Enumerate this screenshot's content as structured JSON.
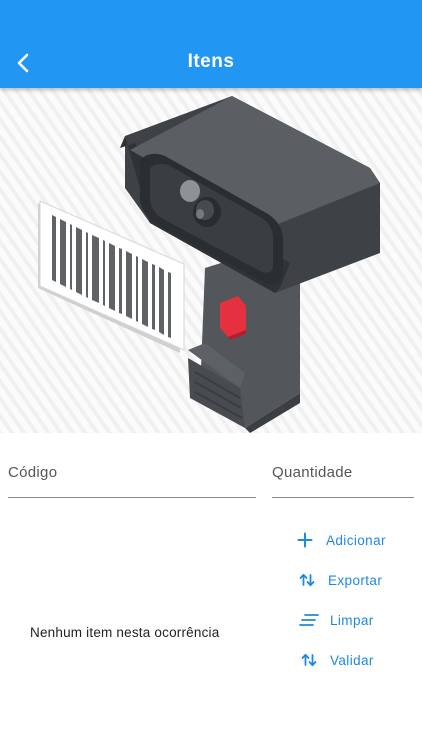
{
  "appbar": {
    "title": "Itens",
    "back_icon": "chevron-left-icon",
    "color": "#2196f3"
  },
  "hero": {
    "image": "barcode-scanner-illustration"
  },
  "form": {
    "code_placeholder": "Código",
    "quantity_placeholder": "Quantidade"
  },
  "empty_message": "Nenhum item nesta ocorrência",
  "actions": [
    {
      "label": "Adicionar",
      "icon": "plus-icon"
    },
    {
      "label": "Exportar",
      "icon": "swap-vertical-icon"
    },
    {
      "label": "Limpar",
      "icon": "clear-lines-icon"
    },
    {
      "label": "Validar",
      "icon": "swap-vertical-icon"
    }
  ],
  "accent_color": "#1e88e5"
}
